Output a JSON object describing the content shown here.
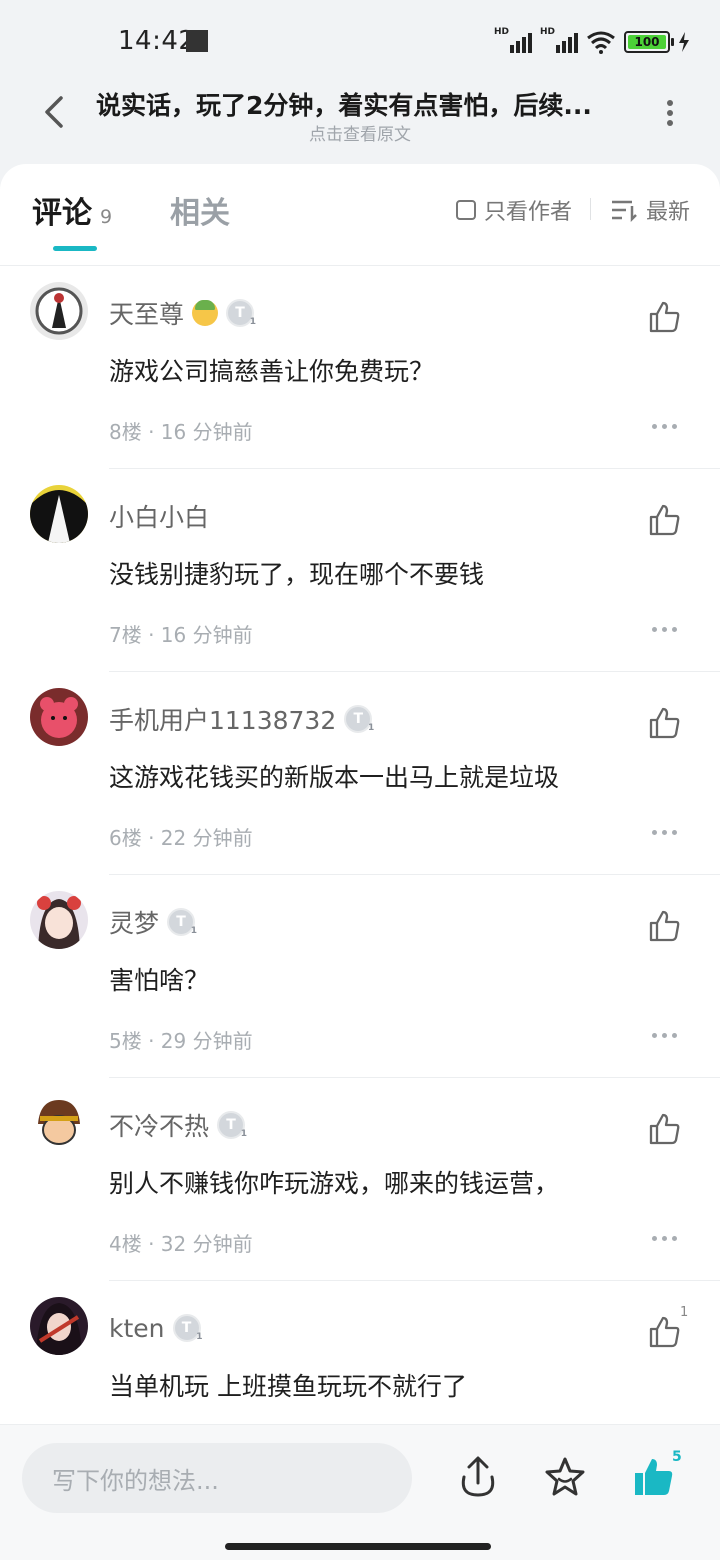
{
  "status_bar": {
    "time": "14:42",
    "battery": "100",
    "hd1": "HD",
    "hd2": "HD"
  },
  "header": {
    "title": "说实话，玩了2分钟，着实有点害怕，后续...",
    "subtitle": "点击查看原文"
  },
  "tabs": {
    "comments_label": "评论",
    "comments_count": "9",
    "related_label": "相关",
    "author_only_label": "只看作者",
    "sort_label": "最新"
  },
  "comments": [
    {
      "name": "天至尊",
      "badge": "T",
      "text": "游戏公司搞慈善让你免费玩？",
      "meta": "8楼 · 16 分钟前",
      "likes": ""
    },
    {
      "name": "小白小白",
      "badge": "",
      "text": "没钱别捷豹玩了，现在哪个不要钱",
      "meta": "7楼 · 16 分钟前",
      "likes": ""
    },
    {
      "name": "手机用户11138732",
      "badge": "T",
      "text": "这游戏花钱买的新版本一出马上就是垃圾",
      "meta": "6楼 · 22 分钟前",
      "likes": ""
    },
    {
      "name": "灵梦",
      "badge": "T",
      "text": "害怕啥？",
      "meta": "5楼 · 29 分钟前",
      "likes": ""
    },
    {
      "name": "不冷不热",
      "badge": "T",
      "text": "别人不赚钱你咋玩游戏，哪来的钱运营，",
      "meta": "4楼 · 32 分钟前",
      "likes": ""
    },
    {
      "name": "kten",
      "badge": "T",
      "text": "当单机玩 上班摸鱼玩玩不就行了",
      "meta": "",
      "likes": "1"
    }
  ],
  "bottom": {
    "input_placeholder": "写下你的想法...",
    "like_count": "5"
  },
  "colors": {
    "accent": "#1ab8c4",
    "battery": "#4cd137"
  }
}
